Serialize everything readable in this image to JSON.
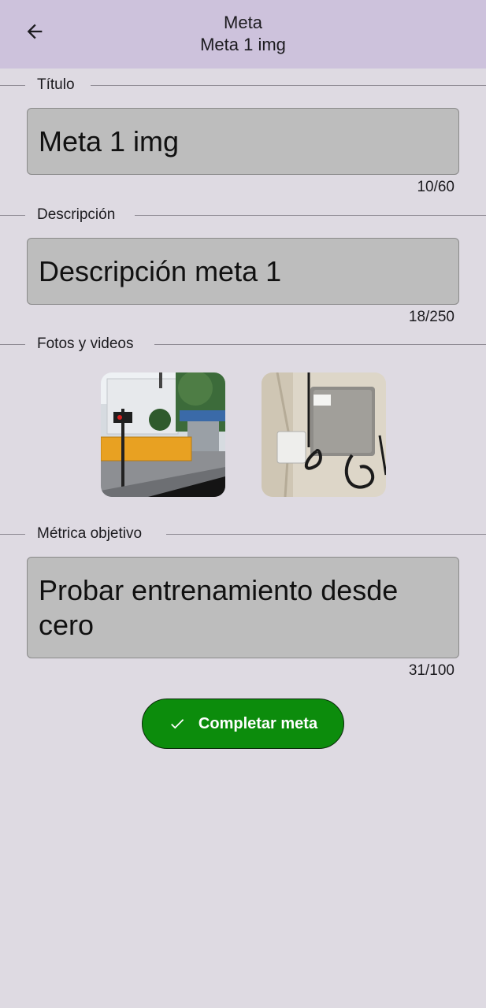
{
  "appbar": {
    "title": "Meta",
    "subtitle": "Meta 1 img",
    "back_icon": "arrow-left-icon"
  },
  "titulo": {
    "label": "Título",
    "value": "Meta 1 img",
    "counter": "10/60"
  },
  "descripcion": {
    "label": "Descripción",
    "value": "Descripción meta 1",
    "counter": "18/250"
  },
  "fotos": {
    "label": "Fotos y videos",
    "items": [
      {
        "kind": "photo",
        "subject": "street-corner"
      },
      {
        "kind": "photo",
        "subject": "wall-electrical-box"
      }
    ]
  },
  "metrica": {
    "label": "Métrica objetivo",
    "value": "Probar entrenamiento desde cero",
    "counter": "31/100"
  },
  "complete_button": {
    "label": "Completar meta",
    "icon": "check-icon",
    "color": "#0c8c0c"
  },
  "colors": {
    "appbar": "#cdc2dc",
    "background": "#dedae2",
    "field": "#bdbdbd"
  }
}
